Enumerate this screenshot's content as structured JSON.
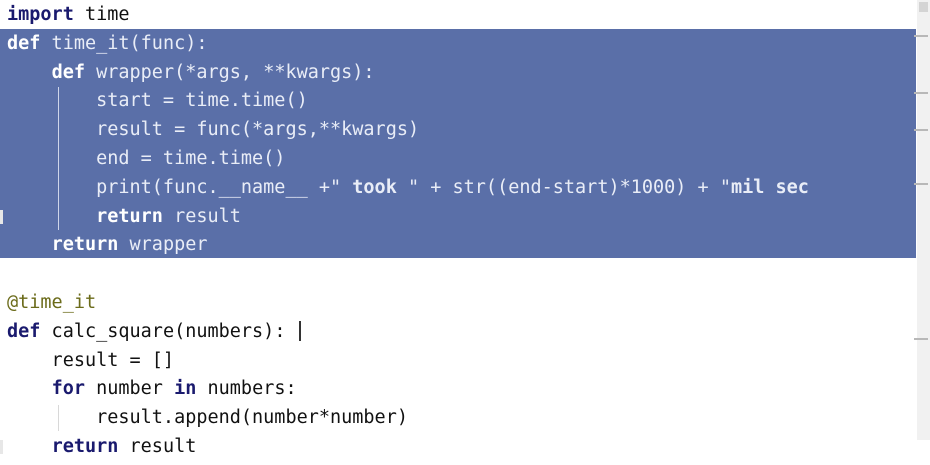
{
  "code_lines": [
    {
      "tokens": [
        {
          "t": "import",
          "kw": true
        },
        {
          "t": " time"
        }
      ],
      "selected": false
    },
    {
      "tokens": [
        {
          "t": "def",
          "kw": true
        },
        {
          "t": " time_it(func):"
        }
      ],
      "selected": true
    },
    {
      "tokens": [
        {
          "t": "    "
        },
        {
          "t": "def",
          "kw": true
        },
        {
          "t": " wrapper(*args, **kwargs):"
        }
      ],
      "selected": true
    },
    {
      "tokens": [
        {
          "t": "        start = time.time()"
        }
      ],
      "selected": true
    },
    {
      "tokens": [
        {
          "t": "        result = func(*args,**kwargs)"
        }
      ],
      "selected": true
    },
    {
      "tokens": [
        {
          "t": "        end = time.time()"
        }
      ],
      "selected": true
    },
    {
      "tokens": [
        {
          "t": "        print(func.__name__ +\""
        },
        {
          "t": " took ",
          "str": true
        },
        {
          "t": "\" + str((end-start)*1000) + \""
        },
        {
          "t": "mil sec",
          "str": true
        }
      ],
      "selected": true
    },
    {
      "tokens": [
        {
          "t": "        "
        },
        {
          "t": "return",
          "kw": true
        },
        {
          "t": " result"
        }
      ],
      "selected": true
    },
    {
      "tokens": [
        {
          "t": "    "
        },
        {
          "t": "return",
          "kw": true
        },
        {
          "t": " wrapper"
        }
      ],
      "selected": true
    },
    {
      "tokens": [
        {
          "t": ""
        }
      ],
      "selected": false
    },
    {
      "tokens": [
        {
          "t": "@time_it",
          "deco": true
        }
      ],
      "selected": false
    },
    {
      "tokens": [
        {
          "t": "def",
          "kw": true
        },
        {
          "t": " calc_square(numbers):"
        }
      ],
      "selected": false
    },
    {
      "tokens": [
        {
          "t": "    result = []"
        }
      ],
      "selected": false
    },
    {
      "tokens": [
        {
          "t": "    "
        },
        {
          "t": "for",
          "kw": true
        },
        {
          "t": " number "
        },
        {
          "t": "in",
          "kw": true
        },
        {
          "t": " numbers:"
        }
      ],
      "selected": false
    },
    {
      "tokens": [
        {
          "t": "        result.append(number*number)"
        }
      ],
      "selected": false
    },
    {
      "tokens": [
        {
          "t": "    "
        },
        {
          "t": "return",
          "kw": true
        },
        {
          "t": " result"
        }
      ],
      "selected": false
    }
  ],
  "colors": {
    "selection": "#5a6fa8",
    "keyword": "#1a1a6e",
    "decorator": "#6b6b1a",
    "background": "#ffffff"
  }
}
